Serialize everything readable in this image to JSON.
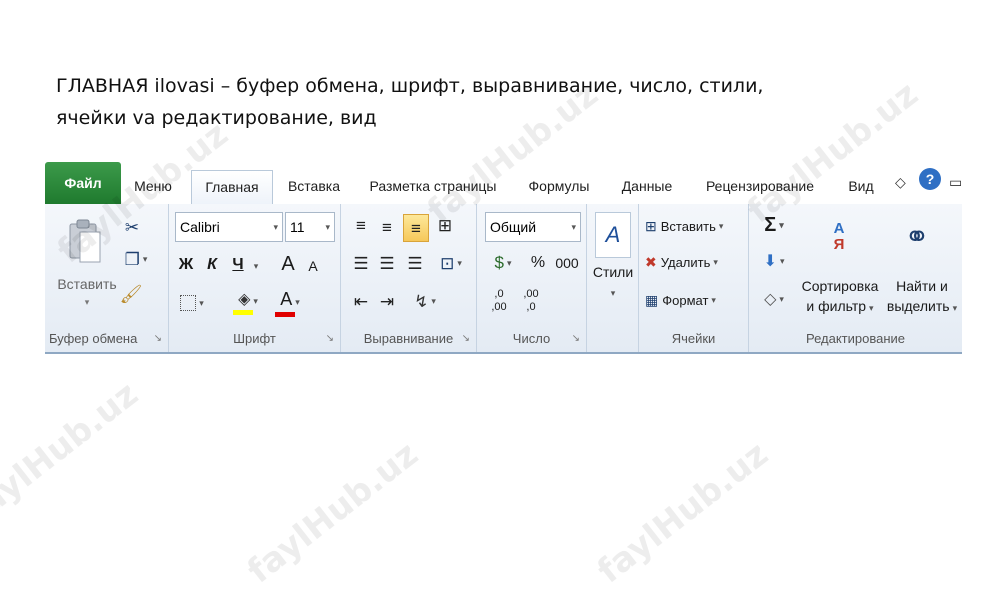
{
  "caption": {
    "line1": "ГЛАВНАЯ ilovasi – буфер обмена, шрифт, выравнивание, число, стили,",
    "line2": "ячейки va редактирование, вид"
  },
  "watermark": "faylHub.uz",
  "tabs": {
    "file": "Файл",
    "menu": "Меню",
    "home": "Главная",
    "insert": "Вставка",
    "layout": "Разметка страницы",
    "formulas": "Формулы",
    "data": "Данные",
    "review": "Рецензирование",
    "view": "Вид"
  },
  "clipboard": {
    "paste": "Вставить",
    "label": "Буфер обмена"
  },
  "font": {
    "name": "Calibri",
    "size": "11",
    "bold": "Ж",
    "italic": "К",
    "underline": "Ч",
    "grow": "A",
    "shrink": "A",
    "color_letter": "A",
    "label": "Шрифт"
  },
  "alignment": {
    "label": "Выравнивание"
  },
  "number": {
    "format": "Общий",
    "percent": "%",
    "thousands": "000",
    "inc_decimal_top": ",0",
    "inc_decimal_bottom": ",00",
    "dec_decimal_top": ",00",
    "dec_decimal_bottom": ",0",
    "label": "Число"
  },
  "styles": {
    "button": "Стили"
  },
  "cells": {
    "insert": "Вставить",
    "delete": "Удалить",
    "format": "Формат",
    "label": "Ячейки"
  },
  "editing": {
    "sum": "Σ",
    "sort_line1": "Сортировка",
    "sort_line2": "и фильтр",
    "find_line1": "Найти и",
    "find_line2": "выделить",
    "sort_icon_top": "А",
    "sort_icon_bottom": "Я",
    "label": "Редактирование"
  },
  "colors": {
    "file_tab": "#2e8b3e",
    "highlight_yellow": "#ffff00",
    "font_red": "#e00000",
    "ribbon_bg": "#eaf0f7",
    "selected": "#f6c85a"
  }
}
